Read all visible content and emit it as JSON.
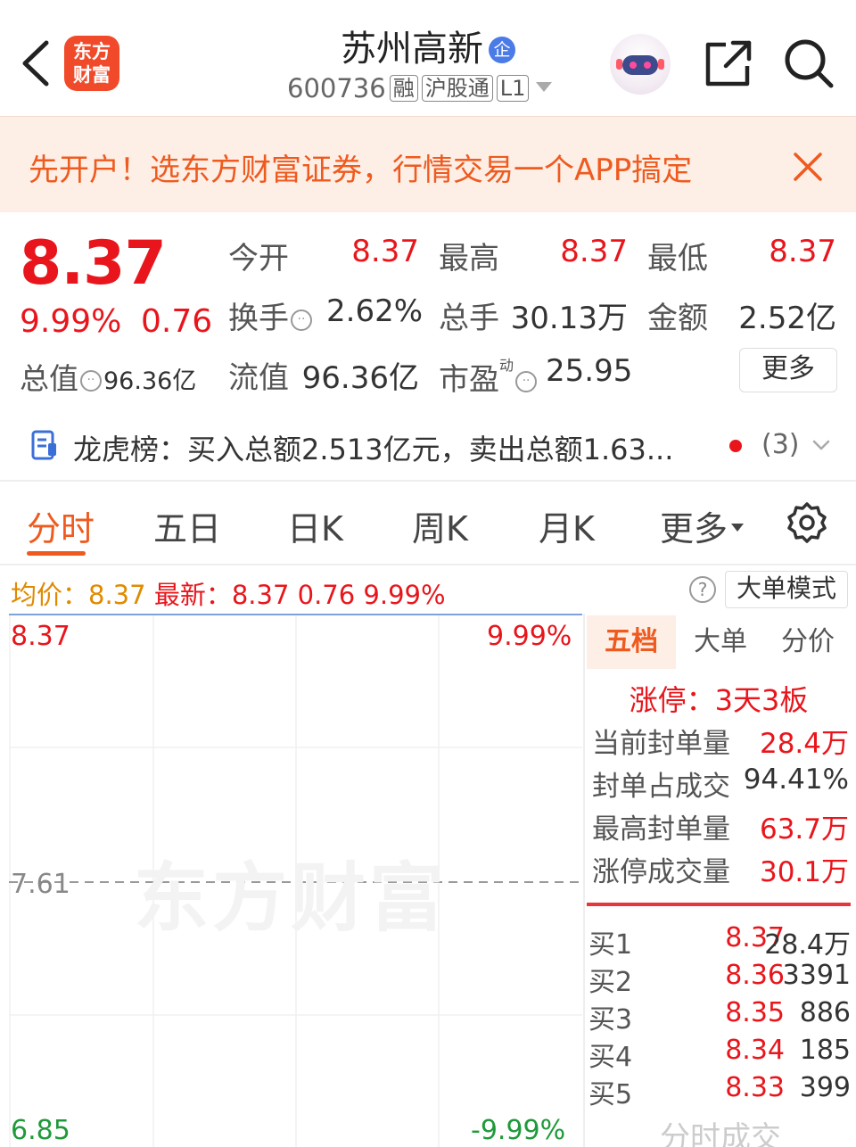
{
  "header": {
    "logo_text_line1": "东方",
    "logo_text_line2": "财富",
    "stock_name": "苏州高新",
    "name_badge": "企",
    "code": "600736",
    "tags": [
      "融",
      "沪股通",
      "L1"
    ]
  },
  "banner": {
    "text": "先开户！选东方财富证券，行情交易一个APP搞定"
  },
  "quote": {
    "price": "8.37",
    "change_pct": "9.99%",
    "change": "0.76",
    "total_value_label": "总值",
    "total_value": "96.36亿",
    "stats": [
      {
        "label": "今开",
        "value": "8.37",
        "color": "red"
      },
      {
        "label": "最高",
        "value": "8.37",
        "color": "red"
      },
      {
        "label": "最低",
        "value": "8.37",
        "color": "red"
      },
      {
        "label": "换手",
        "value": "2.62%",
        "color": "dark"
      },
      {
        "label": "总手",
        "value": "30.13万",
        "color": "dark"
      },
      {
        "label": "金额",
        "value": "2.52亿",
        "color": "dark"
      },
      {
        "label": "流值",
        "value": "96.36亿",
        "color": "dark"
      },
      {
        "label": "市盈",
        "value": "25.95",
        "color": "dark"
      }
    ],
    "pe_superscript": "动",
    "more_label": "更多"
  },
  "dragon_tiger": {
    "text": "龙虎榜：买入总额2.513亿元，卖出总额1.63...",
    "count": "(3)"
  },
  "tabs": [
    "分时",
    "五日",
    "日K",
    "周K",
    "月K",
    "更多"
  ],
  "active_tab": 0,
  "avg_line": {
    "avg_label": "均价：",
    "avg_value": "8.37",
    "latest_label": "最新：",
    "latest_value": "8.37",
    "latest_change": "0.76",
    "latest_pct": "9.99%"
  },
  "help_glyph": "?",
  "mode_button": "大单模式",
  "chart_axis": {
    "top_price": "8.37",
    "top_pct": "9.99%",
    "mid_price": "7.61",
    "bottom_price": "6.85",
    "bottom_pct": "-9.99%"
  },
  "watermark": "东方财富",
  "right_panel": {
    "tabs": [
      "五档",
      "大单",
      "分价"
    ],
    "active_tab": 0,
    "limit_title": "涨停：3天3板",
    "seal_rows": [
      {
        "label": "当前封单量",
        "value": "28.4万",
        "color": "red"
      },
      {
        "label": "封单占成交",
        "value": "94.41%",
        "color": "dark"
      },
      {
        "label": "最高封单量",
        "value": "63.7万",
        "color": "red"
      },
      {
        "label": "涨停成交量",
        "value": "30.1万",
        "color": "red"
      }
    ],
    "bids": [
      {
        "label": "买1",
        "price": "8.37",
        "qty": "28.4万"
      },
      {
        "label": "买2",
        "price": "8.36",
        "qty": "3391"
      },
      {
        "label": "买3",
        "price": "8.35",
        "qty": "886"
      },
      {
        "label": "买4",
        "price": "8.34",
        "qty": "185"
      },
      {
        "label": "买5",
        "price": "8.33",
        "qty": "399"
      }
    ]
  },
  "overlay_text": "分时成交",
  "colors": {
    "up": "#e8161c",
    "accent": "#ef5a1e",
    "down": "#1f9a3a"
  }
}
